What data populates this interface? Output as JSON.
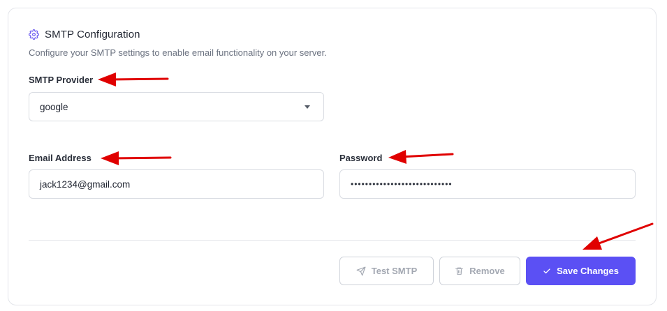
{
  "section": {
    "title": "SMTP Configuration",
    "subtitle": "Configure your SMTP settings to enable email functionality on your server.",
    "icon": "gear-icon"
  },
  "provider": {
    "label": "SMTP Provider",
    "value": "google",
    "icon": "caret-down-icon"
  },
  "email": {
    "label": "Email Address",
    "value": "jack1234@gmail.com"
  },
  "password": {
    "label": "Password",
    "value": "••••••••••••••••••••••••••••"
  },
  "actions": {
    "test_label": "Test SMTP",
    "test_icon": "send-icon",
    "remove_label": "Remove",
    "remove_icon": "trash-icon",
    "save_label": "Save Changes",
    "save_icon": "check-icon"
  },
  "colors": {
    "accent": "#5b50f4",
    "annotation_arrow": "#e00000"
  }
}
